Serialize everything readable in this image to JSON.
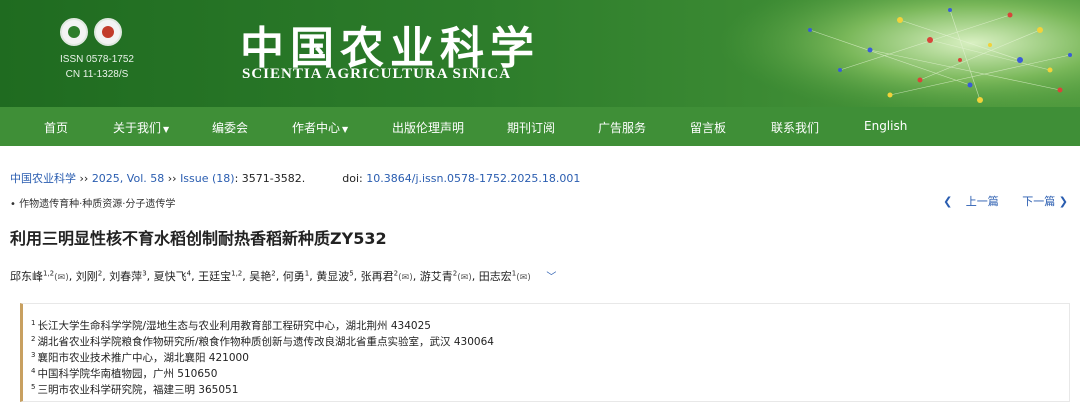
{
  "banner": {
    "issn": "ISSN 0578-1752",
    "cn": "CN 11-1328/S",
    "title_cn": "中国农业科学",
    "title_en": "SCIENTIA AGRICULTURA SINICA"
  },
  "nav": {
    "items": [
      "首页",
      "关于我们",
      "编委会",
      "作者中心",
      "出版伦理声明",
      "期刊订阅",
      "广告服务",
      "留言板",
      "联系我们",
      "English"
    ]
  },
  "citation": {
    "journal": "中国农业科学",
    "sep1": "››",
    "year_vol": "2025, Vol. 58",
    "sep2": "››",
    "issue": "Issue (18)",
    "pages": ": 3571-3582.",
    "doi_label": "doi:",
    "doi": "10.3864/j.issn.0578-1752.2025.18.001"
  },
  "category": "• 作物遗传育种·种质资源·分子遗传学",
  "pager": {
    "prev": "上一篇",
    "next": "下一篇"
  },
  "article": {
    "title": "利用三明显性核不育水稻创制耐热香稻新种质ZY532"
  },
  "authors": [
    {
      "name": "邱东峰",
      "sup": "1,2",
      "mail": "(✉)"
    },
    {
      "name": "刘刚",
      "sup": "2",
      "mail": ""
    },
    {
      "name": "刘春萍",
      "sup": "3",
      "mail": ""
    },
    {
      "name": "夏快飞",
      "sup": "4",
      "mail": ""
    },
    {
      "name": "王廷宝",
      "sup": "1,2",
      "mail": ""
    },
    {
      "name": "吴艳",
      "sup": "2",
      "mail": ""
    },
    {
      "name": "何勇",
      "sup": "1",
      "mail": ""
    },
    {
      "name": "黄显波",
      "sup": "5",
      "mail": ""
    },
    {
      "name": "张再君",
      "sup": "2",
      "mail": "(✉)"
    },
    {
      "name": "游艾青",
      "sup": "2",
      "mail": "(✉)"
    },
    {
      "name": "田志宏",
      "sup": "1",
      "mail": "(✉)"
    }
  ],
  "affiliations": [
    {
      "num": "1",
      "text": "长江大学生命科学学院/湿地生态与农业利用教育部工程研究中心，湖北荆州 434025"
    },
    {
      "num": "2",
      "text": "湖北省农业科学院粮食作物研究所/粮食作物种质创新与遗传改良湖北省重点实验室，武汉 430064"
    },
    {
      "num": "3",
      "text": "襄阳市农业技术推广中心，湖北襄阳 421000"
    },
    {
      "num": "4",
      "text": "中国科学院华南植物园，广州 510650"
    },
    {
      "num": "5",
      "text": "三明市农业科学研究院，福建三明 365051"
    }
  ],
  "colors": {
    "banner_green": "#2d7d2b",
    "nav_green": "#3f8f37",
    "link_blue": "#2a5db0",
    "affil_border": "#c8a060"
  }
}
